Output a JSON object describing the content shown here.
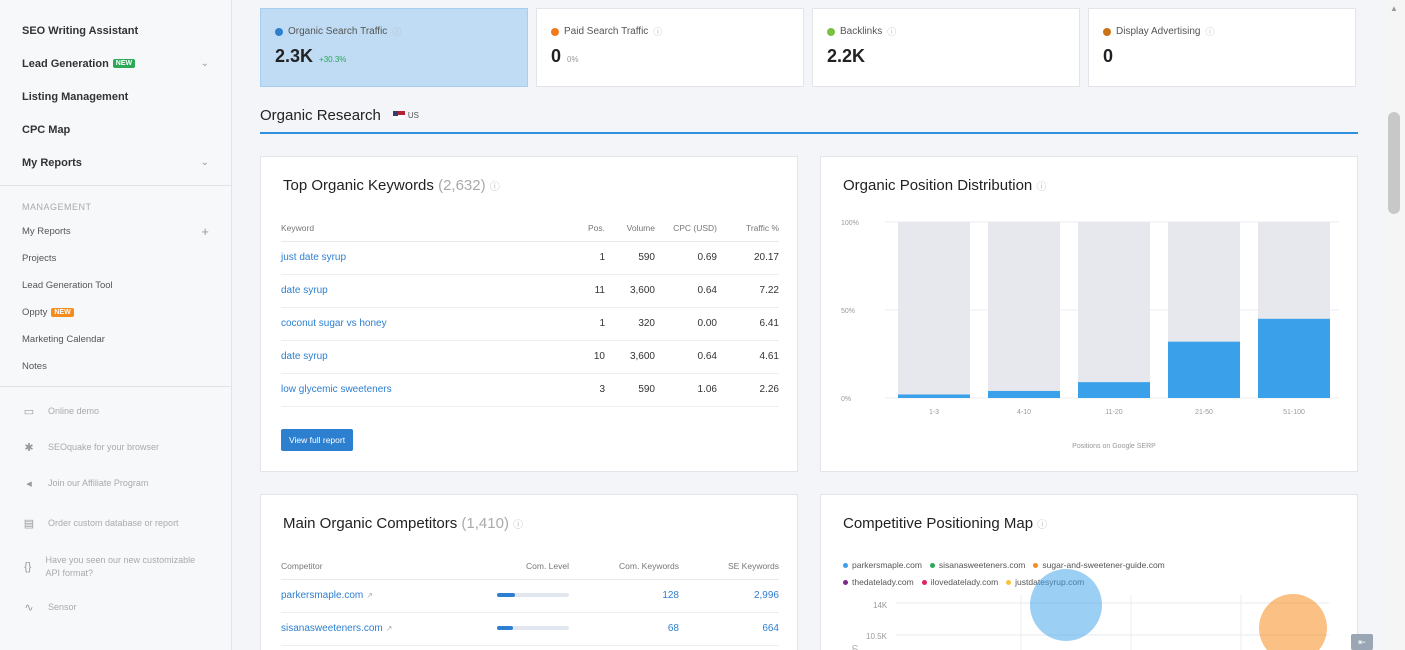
{
  "sidebar": {
    "top_items": [
      {
        "label": "SEO Writing Assistant",
        "badge": "",
        "chevron": false
      },
      {
        "label": "Lead Generation",
        "badge": "NEW",
        "chevron": true
      },
      {
        "label": "Listing Management",
        "badge": "",
        "chevron": false
      },
      {
        "label": "CPC Map",
        "badge": "",
        "chevron": false
      },
      {
        "label": "My Reports",
        "badge": "",
        "chevron": true
      }
    ],
    "management_heading": "MANAGEMENT",
    "management_items": [
      {
        "label": "My Reports",
        "badge": "",
        "plus": true
      },
      {
        "label": "Projects",
        "badge": "",
        "plus": false
      },
      {
        "label": "Lead Generation Tool",
        "badge": "",
        "plus": false
      },
      {
        "label": "Oppty",
        "badge": "NEW",
        "plus": false
      },
      {
        "label": "Marketing Calendar",
        "badge": "",
        "plus": false
      },
      {
        "label": "Notes",
        "badge": "",
        "plus": false
      }
    ],
    "lower_items": [
      {
        "icon": "monitor-icon",
        "label": "Online demo"
      },
      {
        "icon": "seoquake-icon",
        "label": "SEOquake for your browser"
      },
      {
        "icon": "megaphone-icon",
        "label": "Join our Affiliate Program"
      },
      {
        "icon": "database-icon",
        "label": "Order custom database or report"
      },
      {
        "icon": "api-icon",
        "label": "Have you seen our new customizable API format?"
      },
      {
        "icon": "sensor-icon",
        "label": "Sensor"
      }
    ]
  },
  "metrics": [
    {
      "label": "Organic Search Traffic",
      "value": "2.3K",
      "sub": "+30.3%",
      "color": "#2d7fd0",
      "active": true
    },
    {
      "label": "Paid Search Traffic",
      "value": "0",
      "sub": "0%",
      "color": "#f07b1d",
      "active": false
    },
    {
      "label": "Backlinks",
      "value": "2.2K",
      "sub": "",
      "color": "#7bc043",
      "active": false
    },
    {
      "label": "Display Advertising",
      "value": "0",
      "sub": "",
      "color": "#c87415",
      "active": false
    }
  ],
  "section": {
    "title": "Organic Research",
    "flag": "US"
  },
  "keywords_card": {
    "title": "Top Organic Keywords",
    "count": "(2,632)",
    "headers": [
      "Keyword",
      "Pos.",
      "Volume",
      "CPC (USD)",
      "Traffic %"
    ],
    "rows": [
      [
        "just date syrup",
        "1",
        "590",
        "0.69",
        "20.17"
      ],
      [
        "date syrup",
        "11",
        "3,600",
        "0.64",
        "7.22"
      ],
      [
        "coconut sugar vs honey",
        "1",
        "320",
        "0.00",
        "6.41"
      ],
      [
        "date syrup",
        "10",
        "3,600",
        "0.64",
        "4.61"
      ],
      [
        "low glycemic sweeteners",
        "3",
        "590",
        "1.06",
        "2.26"
      ]
    ],
    "button": "View full report"
  },
  "distribution_card": {
    "title": "Organic Position Distribution",
    "xlabel": "Positions on Google SERP"
  },
  "chart_data": {
    "type": "bar",
    "title": "Organic Position Distribution",
    "categories": [
      "1-3",
      "4-10",
      "11-20",
      "21-50",
      "51-100"
    ],
    "values": [
      2,
      4,
      9,
      32,
      45
    ],
    "ylim": [
      0,
      100
    ],
    "yticks": [
      "0%",
      "50%",
      "100%"
    ],
    "xlabel": "Positions on Google SERP",
    "ylabel": "",
    "bar_color": "#3aa0ea",
    "track_color": "#e6e8ee"
  },
  "competitors_card": {
    "title": "Main Organic Competitors",
    "count": "(1,410)",
    "headers": [
      "Competitor",
      "Com. Level",
      "Com. Keywords",
      "SE Keywords"
    ],
    "rows": [
      {
        "name": "parkersmaple.com",
        "level": 0.25,
        "common": "128",
        "se": "2,996"
      },
      {
        "name": "sisanasweeteners.com",
        "level": 0.22,
        "common": "68",
        "se": "664"
      }
    ]
  },
  "map_card": {
    "title": "Competitive Positioning Map",
    "legend": [
      {
        "label": "parkersmaple.com",
        "color": "#3aa0ea"
      },
      {
        "label": "sisanasweeteners.com",
        "color": "#2ca856"
      },
      {
        "label": "sugar-and-sweetener-guide.com",
        "color": "#f58c1f"
      },
      {
        "label": "thedatelady.com",
        "color": "#7b2a8c"
      },
      {
        "label": "ilovedatelady.com",
        "color": "#e0245e"
      },
      {
        "label": "justdatesyrup.com",
        "color": "#f5c43a"
      }
    ],
    "yticks": [
      "14K",
      "10.5K"
    ]
  }
}
